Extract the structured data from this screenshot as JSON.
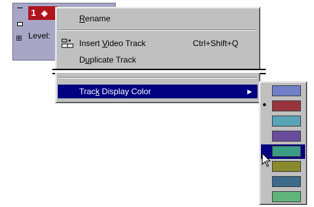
{
  "track": {
    "number": "1",
    "level_label": "Level:",
    "badge_color": "#b0141c",
    "panel_color": "#a7a6c6"
  },
  "menu": {
    "items": [
      {
        "label_prefix": "",
        "label_mnemonic": "R",
        "label_rest": "ename",
        "shortcut": ""
      },
      {
        "label_prefix": "Insert ",
        "label_mnemonic": "V",
        "label_rest": "ideo Track",
        "shortcut": "Ctrl+Shift+Q",
        "icon": "insert-video-track-icon"
      },
      {
        "label_prefix": "D",
        "label_mnemonic": "u",
        "label_rest": "plicate Track",
        "shortcut": ""
      },
      {
        "label_prefix": "Trac",
        "label_mnemonic": "k",
        "label_rest": " Display Color",
        "shortcut": "",
        "highlighted": true
      }
    ],
    "highlight_color": "#000080"
  },
  "color_submenu": {
    "swatches": [
      {
        "color": "#6f7fc8",
        "checked": false,
        "hovered": false
      },
      {
        "color": "#98343c",
        "checked": true,
        "hovered": false
      },
      {
        "color": "#5aa4b8",
        "checked": false,
        "hovered": false
      },
      {
        "color": "#6a4c9c",
        "checked": false,
        "hovered": false
      },
      {
        "color": "#3b9c86",
        "checked": false,
        "hovered": true
      },
      {
        "color": "#8a8a2c",
        "checked": false,
        "hovered": false
      },
      {
        "color": "#3e6a8c",
        "checked": false,
        "hovered": false
      },
      {
        "color": "#5fb47a",
        "checked": false,
        "hovered": false
      }
    ]
  },
  "icons": {
    "submenu_arrow": "right-triangle-icon",
    "check": "bullet-check-icon",
    "cursor": "arrow-cursor-icon"
  }
}
